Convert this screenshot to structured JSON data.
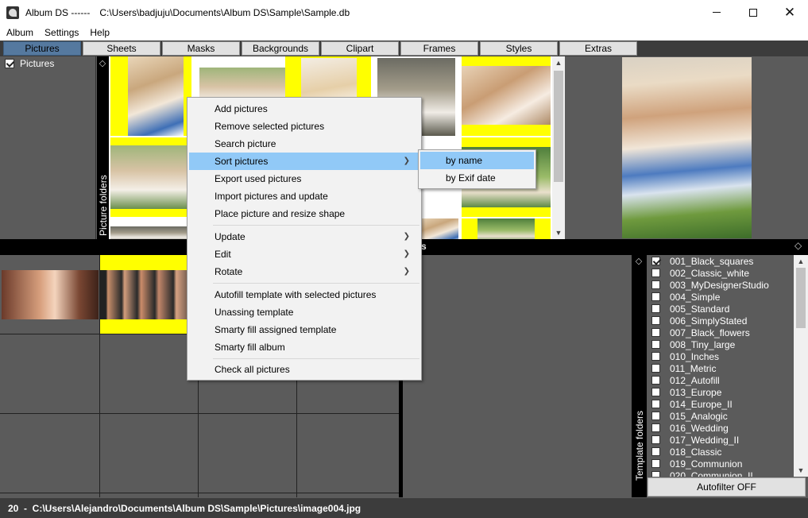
{
  "window": {
    "app_name": "Album DS ------",
    "file_path": "C:\\Users\\badjuju\\Documents\\Album DS\\Sample\\Sample.db"
  },
  "menubar": [
    "Album",
    "Settings",
    "Help"
  ],
  "tabs": [
    "Pictures",
    "Sheets",
    "Masks",
    "Backgrounds",
    "Clipart",
    "Frames",
    "Styles",
    "Extras"
  ],
  "active_tab": "Pictures",
  "left_tree": {
    "label": "Pictures",
    "checked": true
  },
  "picture_folders_label": "Picture folders",
  "template_folders_label": "Template folders",
  "middle_strip_fragment": "s",
  "context_menu": {
    "items": [
      {
        "label": "Add pictures"
      },
      {
        "label": "Remove selected pictures"
      },
      {
        "label": "Search picture"
      },
      {
        "label": "Sort pictures",
        "submenu": true,
        "highlighted": true
      },
      {
        "label": "Export used pictures"
      },
      {
        "label": "Import pictures and update"
      },
      {
        "label": "Place picture and resize shape"
      },
      {
        "label": "Update",
        "submenu": true
      },
      {
        "label": "Edit",
        "submenu": true
      },
      {
        "label": "Rotate",
        "submenu": true
      },
      {
        "label": "Autofill template with selected pictures"
      },
      {
        "label": "Unassing template"
      },
      {
        "label": "Smarty fill assigned template"
      },
      {
        "label": "Smarty fill album"
      },
      {
        "label": "Check all pictures"
      }
    ]
  },
  "sort_submenu": [
    "by name",
    "by Exif date"
  ],
  "templates": [
    {
      "name": "001_Black_squares",
      "checked": true
    },
    {
      "name": "002_Classic_white",
      "checked": false
    },
    {
      "name": "003_MyDesignerStudio",
      "checked": false
    },
    {
      "name": "004_Simple",
      "checked": false
    },
    {
      "name": "005_Standard",
      "checked": false
    },
    {
      "name": "006_SimplyStated",
      "checked": false
    },
    {
      "name": "007_Black_flowers",
      "checked": false
    },
    {
      "name": "008_Tiny_large",
      "checked": false
    },
    {
      "name": "010_Inches",
      "checked": false
    },
    {
      "name": "011_Metric",
      "checked": false
    },
    {
      "name": "012_Autofill",
      "checked": false
    },
    {
      "name": "013_Europe",
      "checked": false
    },
    {
      "name": "014_Europe_II",
      "checked": false
    },
    {
      "name": "015_Analogic",
      "checked": false
    },
    {
      "name": "016_Wedding",
      "checked": false
    },
    {
      "name": "017_Wedding_II",
      "checked": false
    },
    {
      "name": "018_Classic",
      "checked": false
    },
    {
      "name": "019_Communion",
      "checked": false
    },
    {
      "name": "020_Communion_II",
      "checked": false
    }
  ],
  "autofilter_label": "Autofilter OFF",
  "status": "20  -  C:\\Users\\Alejandro\\Documents\\Album DS\\Sample\\Pictures\\image004.jpg",
  "colors": {
    "selection_yellow": "#ffff00",
    "menu_highlight": "#91c9f7",
    "active_tab": "#55799f"
  }
}
